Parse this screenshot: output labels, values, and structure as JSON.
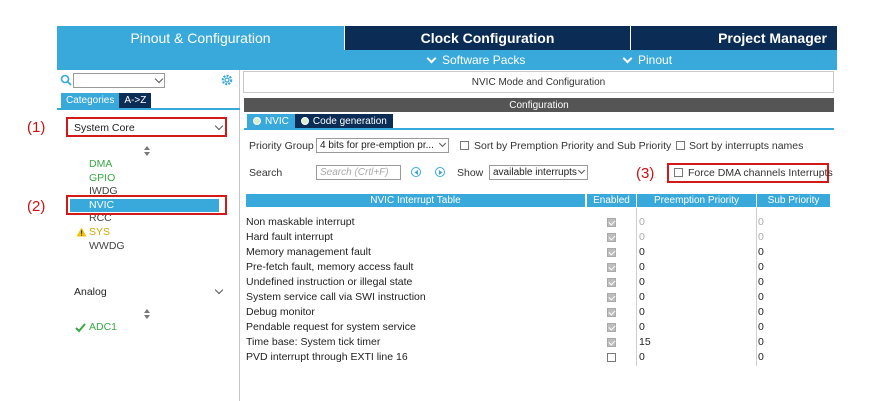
{
  "top_tabs": {
    "pinout": "Pinout & Configuration",
    "clock": "Clock Configuration",
    "project": "Project Manager"
  },
  "subbar": {
    "software_packs": "Software Packs",
    "pinout": "Pinout"
  },
  "left": {
    "search_value": "",
    "category_tabs": [
      "Categories",
      "A->Z"
    ],
    "system_core": {
      "title": "System Core",
      "items": [
        {
          "label": "DMA",
          "status": "enabled"
        },
        {
          "label": "GPIO",
          "status": "enabled"
        },
        {
          "label": "IWDG",
          "status": "none"
        },
        {
          "label": "NVIC",
          "status": "selected"
        },
        {
          "label": "RCC",
          "status": "none"
        },
        {
          "label": "SYS",
          "status": "warning"
        },
        {
          "label": "WWDG",
          "status": "none"
        }
      ]
    },
    "analog": {
      "title": "Analog",
      "items": [
        {
          "label": "ADC1",
          "status": "checked"
        }
      ]
    }
  },
  "annotations": [
    "(1)",
    "(2)",
    "(3)"
  ],
  "right": {
    "header": "NVIC Mode and Configuration",
    "config_title": "Configuration",
    "tabs": [
      "NVIC",
      "Code generation"
    ],
    "priority_group_label": "Priority Group",
    "priority_group_value": "4 bits for pre-emption pr...",
    "sort_premption_label": "Sort by Premption Priority and Sub Priority",
    "sort_names_label": "Sort by interrupts names",
    "search_label": "Search",
    "search_placeholder": "Search (Crtl+F)",
    "show_label": "Show",
    "show_value": "available interrupts",
    "force_dma_label": "Force DMA channels Interrupts",
    "table": {
      "headers": [
        "NVIC Interrupt Table",
        "Enabled",
        "Preemption Priority",
        "Sub Priority"
      ],
      "rows": [
        {
          "name": "Non maskable interrupt",
          "enabled": true,
          "locked": true,
          "preemption": "0",
          "sub": "0"
        },
        {
          "name": "Hard fault interrupt",
          "enabled": true,
          "locked": true,
          "preemption": "0",
          "sub": "0"
        },
        {
          "name": "Memory management fault",
          "enabled": true,
          "locked": true,
          "preemption": "0",
          "sub": "0"
        },
        {
          "name": "Pre-fetch fault, memory access fault",
          "enabled": true,
          "locked": true,
          "preemption": "0",
          "sub": "0"
        },
        {
          "name": "Undefined instruction or illegal state",
          "enabled": true,
          "locked": true,
          "preemption": "0",
          "sub": "0"
        },
        {
          "name": "System service call via SWI instruction",
          "enabled": true,
          "locked": true,
          "preemption": "0",
          "sub": "0"
        },
        {
          "name": "Debug monitor",
          "enabled": true,
          "locked": true,
          "preemption": "0",
          "sub": "0"
        },
        {
          "name": "Pendable request for system service",
          "enabled": true,
          "locked": true,
          "preemption": "0",
          "sub": "0"
        },
        {
          "name": "Time base: System tick timer",
          "enabled": true,
          "locked": true,
          "preemption": "15",
          "sub": "0"
        },
        {
          "name": "PVD interrupt through EXTI line 16",
          "enabled": false,
          "locked": false,
          "preemption": "0",
          "sub": "0"
        }
      ]
    }
  }
}
